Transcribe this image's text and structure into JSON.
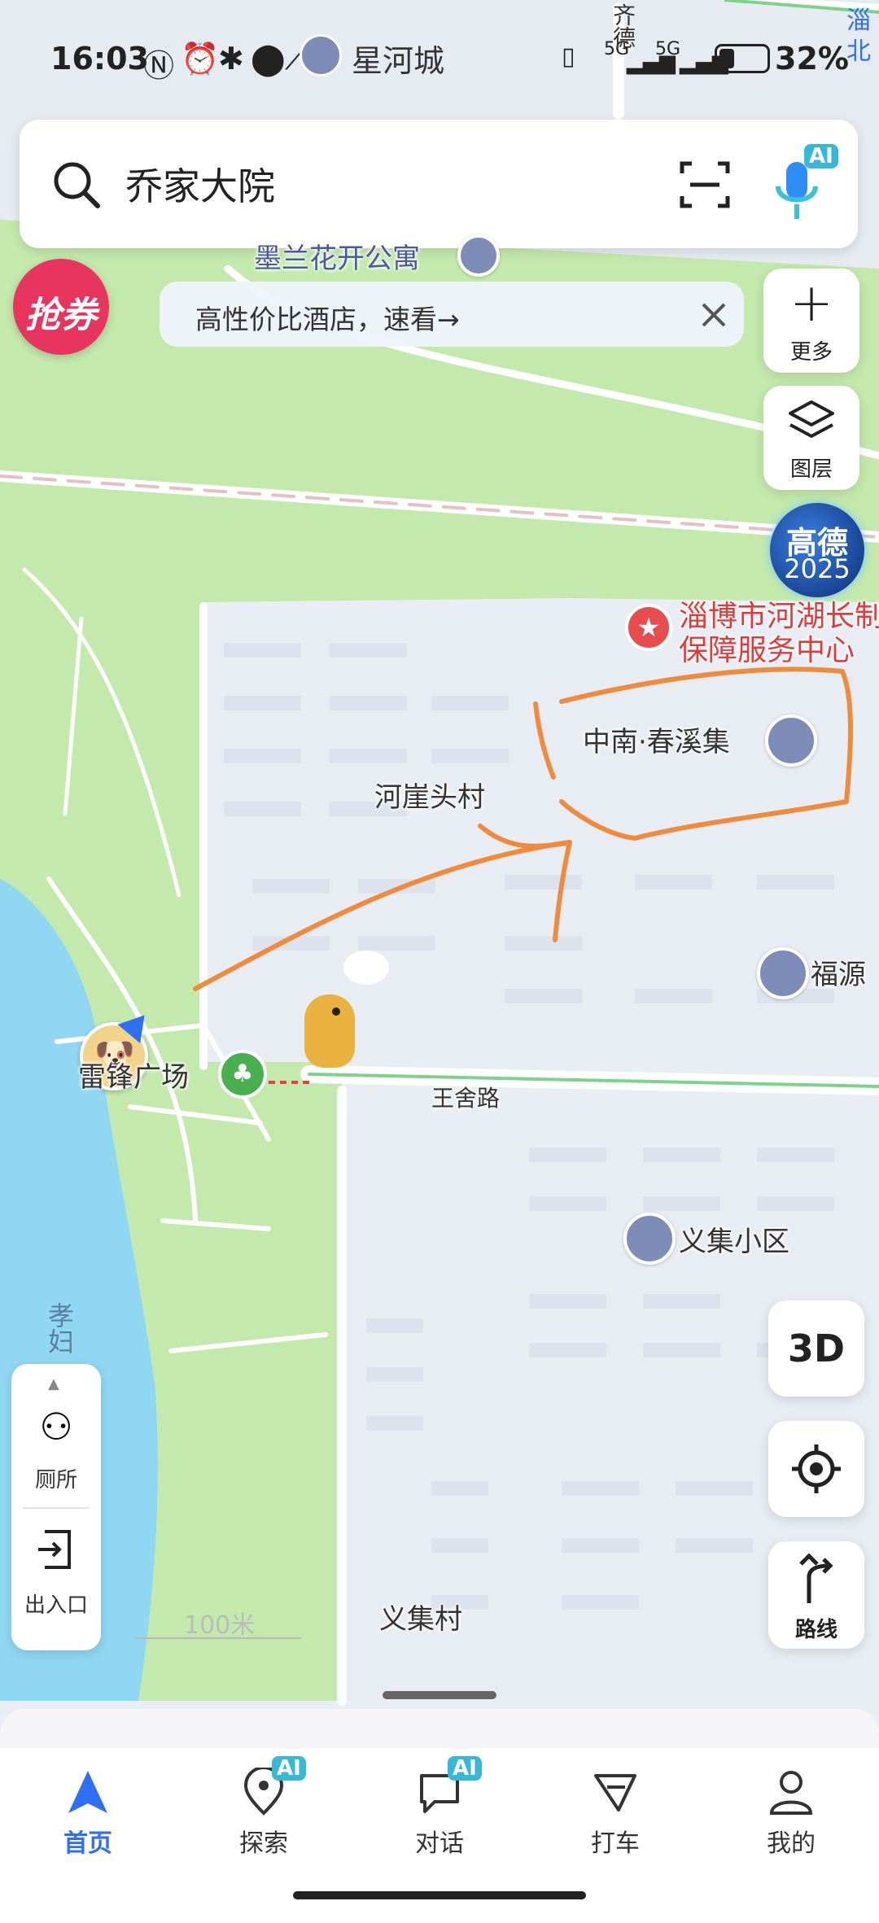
{
  "status_bar": {
    "time": "16:03",
    "battery": "32%",
    "network_1": "5G",
    "network_2": "5G",
    "place_label": "星河城"
  },
  "search": {
    "value": "乔家大院",
    "scan_icon": "scan-icon",
    "voice_badge": "AI"
  },
  "promo": {
    "coupon_label": "抢券",
    "tip_text": "高性价比酒店，速看→"
  },
  "right_tools": {
    "more_label": "更多",
    "layers_label": "图层",
    "brand_line1": "高德",
    "brand_line2": "2025",
    "mode_3d": "3D",
    "route_label": "路线"
  },
  "map_labels": {
    "partial_top_1": "墨兰花开公寓",
    "road_north": "齐德",
    "partial_right_1": "淄",
    "partial_right_2": "北",
    "poi_service_line1": "淄博市河湖长制",
    "poi_service_line2": "保障服务中心",
    "poi_chunxi": "中南·春溪集",
    "village_hyatoucun": "河崖头村",
    "poi_fuyuan": "福源",
    "square_label": "雷锋广场",
    "road_wangshe": "王舍路",
    "poi_yiji_community": "义集小区",
    "village_yiji": "义集村",
    "lake_label": "孝妇",
    "scale_text": "100米"
  },
  "left_panel": {
    "toilet_label": "厕所",
    "entrance_label": "出入口"
  },
  "bottom_nav": [
    {
      "label": "首页",
      "active": true
    },
    {
      "label": "探索",
      "badge": "AI"
    },
    {
      "label": "对话",
      "badge": "AI"
    },
    {
      "label": "打车"
    },
    {
      "label": "我的"
    }
  ],
  "colors": {
    "park_green": "#bfe7a6",
    "water_blue": "#8ed6f2",
    "road_white": "#ffffff",
    "annotation_orange": "#f08a3c",
    "brand_blue": "#2f6ff5"
  }
}
